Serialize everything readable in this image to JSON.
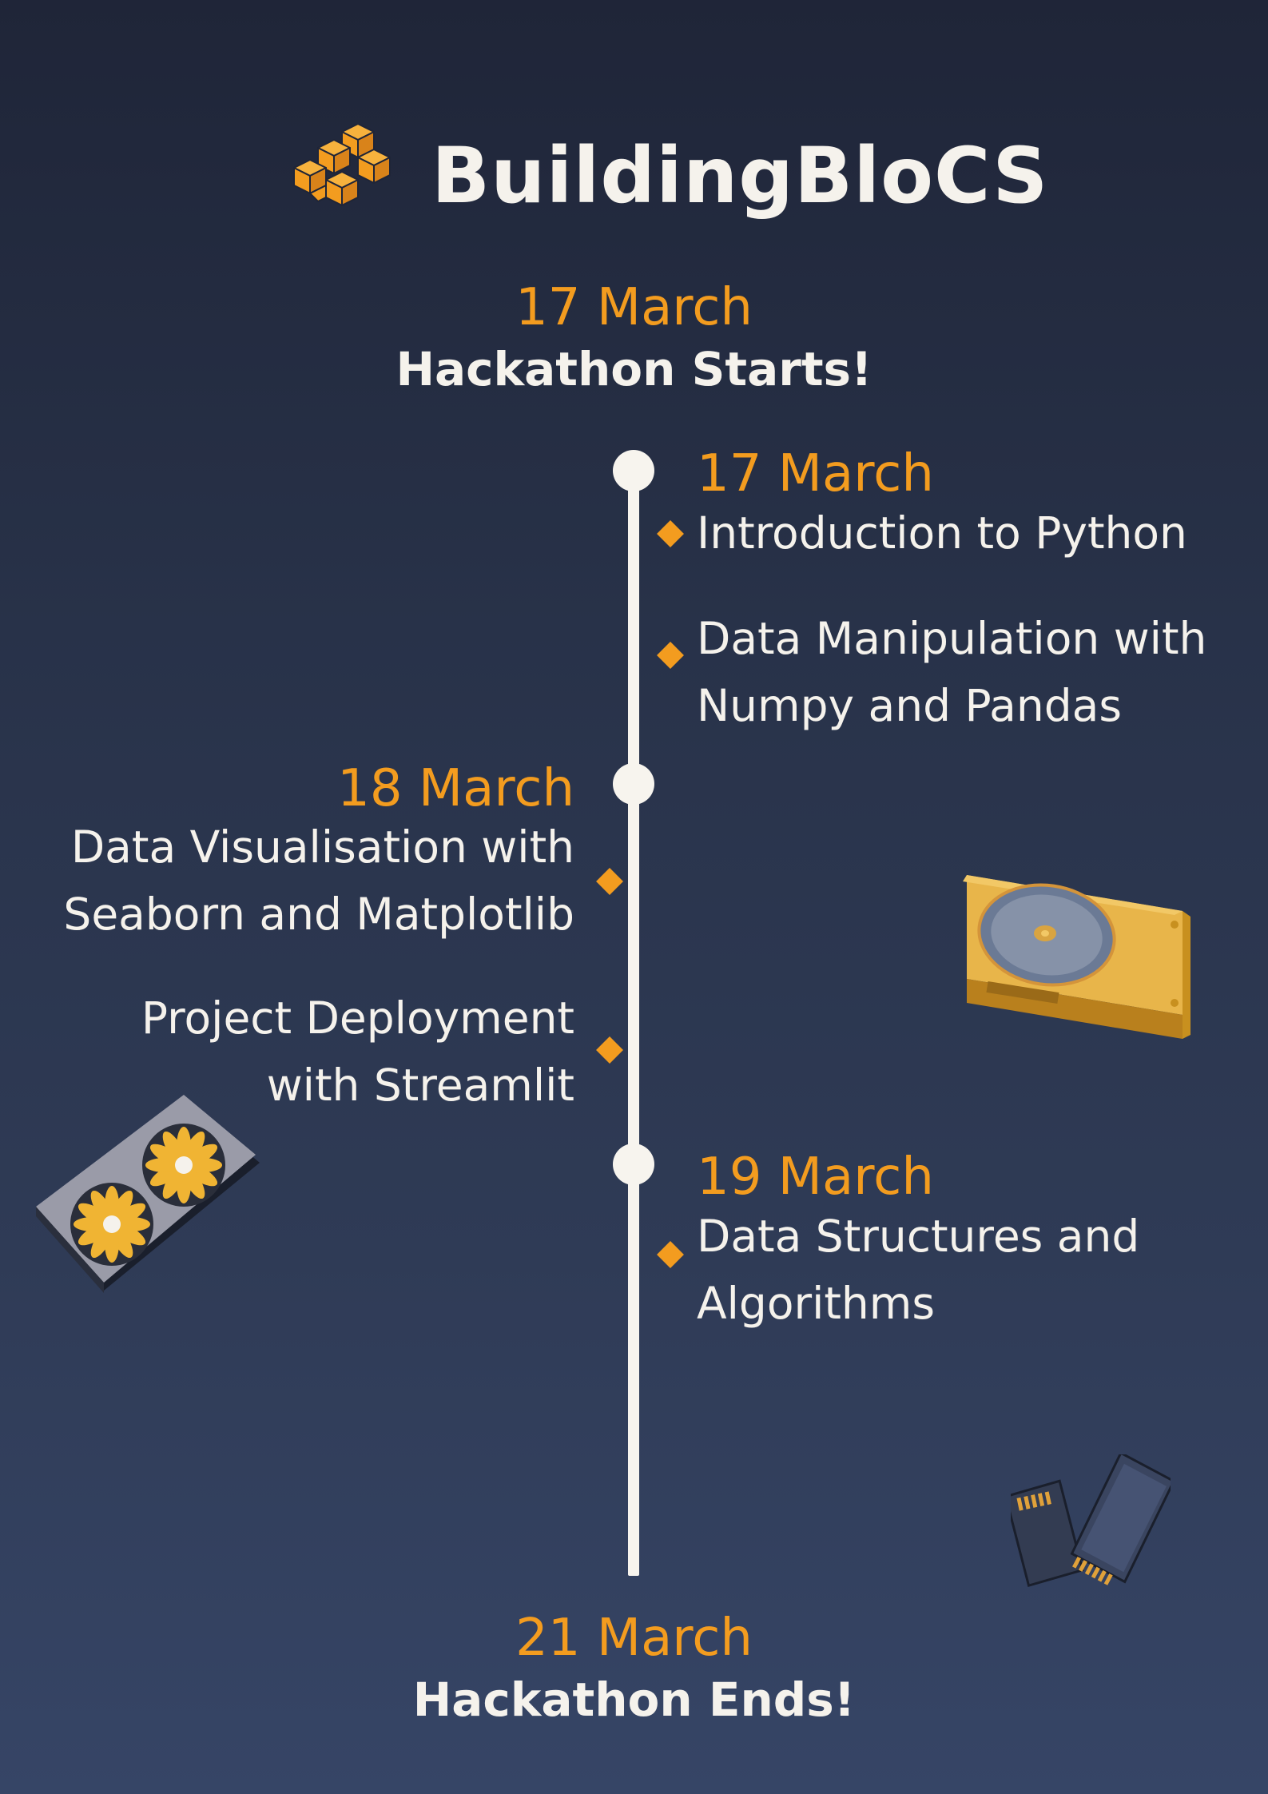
{
  "brand": {
    "name": "BuildingBloCS",
    "logo_icon": "stacked-cubes-icon"
  },
  "start": {
    "date": "17 March",
    "title": "Hackathon Starts!"
  },
  "end": {
    "date": "21 March",
    "title": "Hackathon Ends!"
  },
  "days": [
    {
      "date": "17 March",
      "items": [
        "Introduction to Python",
        "Data Manipulation with\nNumpy and Pandas"
      ]
    },
    {
      "date": "18 March",
      "items": [
        "Data Visualisation with\nSeaborn and Matplotlib",
        "Project Deployment\nwith Streamlit"
      ]
    },
    {
      "date": "19 March",
      "items": [
        "Data Structures and\nAlgorithms"
      ]
    }
  ],
  "colors": {
    "accent": "#f39c1f",
    "text": "#f5f2ec",
    "background_top": "#1f2538",
    "background_bottom": "#364566"
  },
  "illustrations": [
    "hard-drive-icon",
    "graphics-card-icon",
    "sd-card-icon"
  ]
}
